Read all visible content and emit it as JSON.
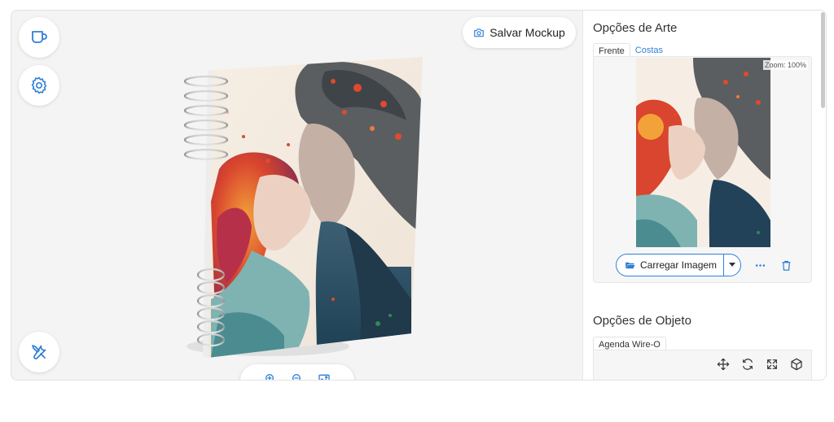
{
  "toolbar": {
    "save_label": "Salvar Mockup",
    "left_buttons": [
      "mug-icon",
      "gear-icon",
      "tools-icon"
    ],
    "zoom_buttons": [
      "zoom-in-icon",
      "zoom-out-icon",
      "image-icon"
    ]
  },
  "panel": {
    "art": {
      "title": "Opções de Arte",
      "tabs": [
        {
          "label": "Frente",
          "active": true
        },
        {
          "label": "Costas",
          "active": false
        }
      ],
      "zoom_label": "Zoom: 100%",
      "upload_label": "Carregar Imagem"
    },
    "object": {
      "title": "Opções de Objeto",
      "tab_label": "Agenda Wire-O",
      "tools": [
        "move-icon",
        "rotate-icon",
        "expand-icon",
        "cube-icon"
      ]
    }
  },
  "colors": {
    "accent": "#2f7fd8",
    "viewport_bg": "#f4f4f4"
  }
}
